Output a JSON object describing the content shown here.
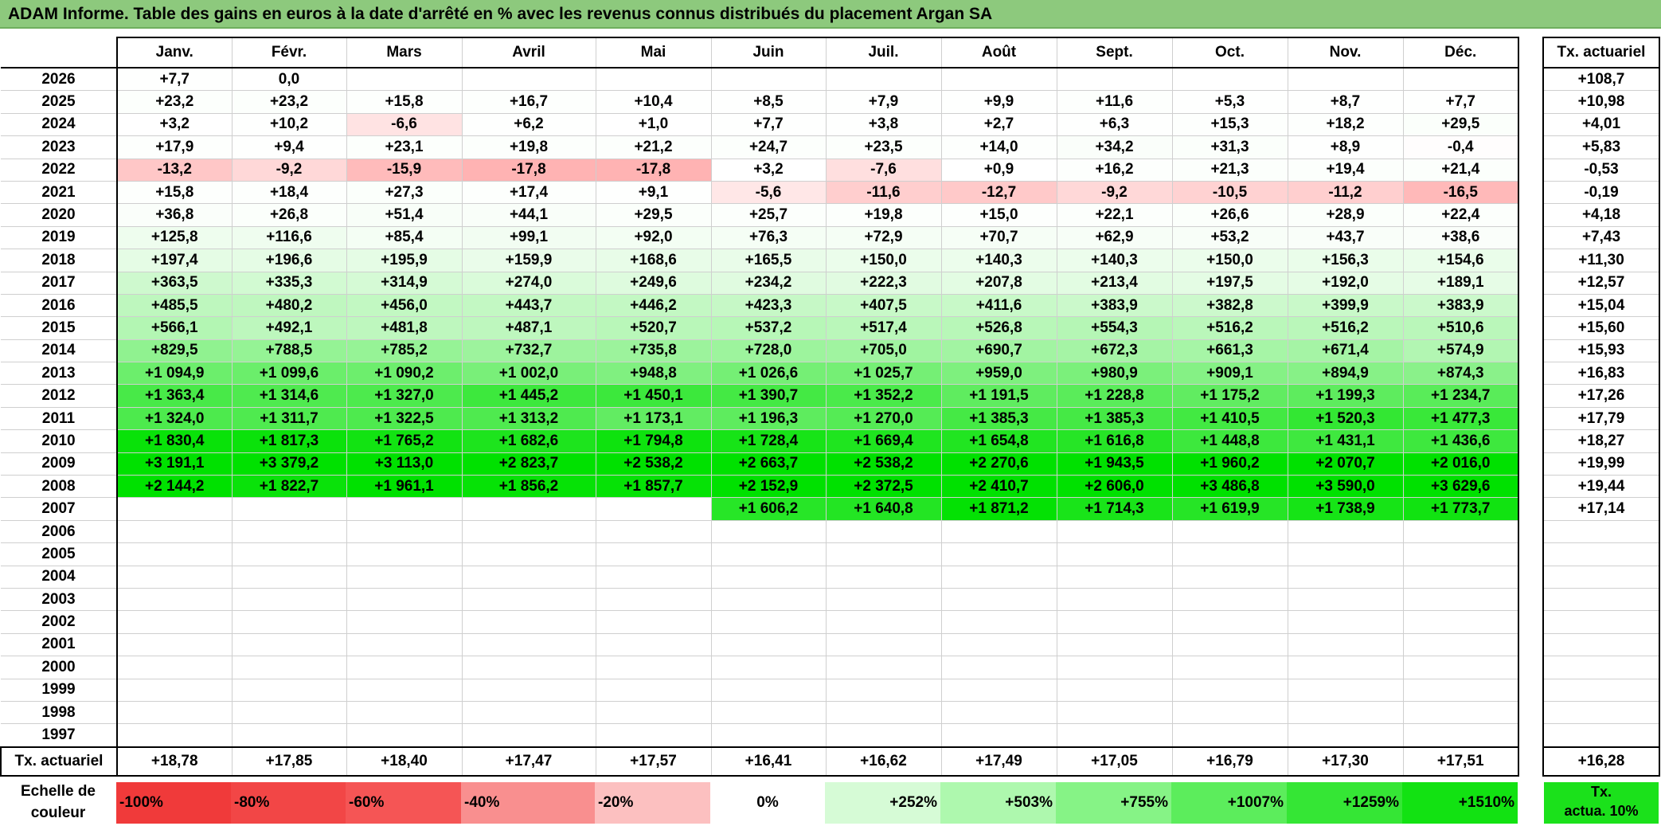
{
  "title": "ADAM Informe. Table des gains en euros à la date d'arrêté en % avec les revenus connus distribués du placement Argan SA",
  "months": [
    "Janv.",
    "Févr.",
    "Mars",
    "Avril",
    "Mai",
    "Juin",
    "Juil.",
    "Août",
    "Sept.",
    "Oct.",
    "Nov.",
    "Déc."
  ],
  "side_header": "Tx. actuariel",
  "rows": [
    {
      "year": "2026",
      "values": [
        "+7,7",
        "0,0",
        "",
        "",
        "",
        "",
        "",
        "",
        "",
        "",
        "",
        ""
      ],
      "tx": "+108,7"
    },
    {
      "year": "2025",
      "values": [
        "+23,2",
        "+23,2",
        "+15,8",
        "+16,7",
        "+10,4",
        "+8,5",
        "+7,9",
        "+9,9",
        "+11,6",
        "+5,3",
        "+8,7",
        "+7,7"
      ],
      "tx": "+10,98"
    },
    {
      "year": "2024",
      "values": [
        "+3,2",
        "+10,2",
        "-6,6",
        "+6,2",
        "+1,0",
        "+7,7",
        "+3,8",
        "+2,7",
        "+6,3",
        "+15,3",
        "+18,2",
        "+29,5"
      ],
      "tx": "+4,01"
    },
    {
      "year": "2023",
      "values": [
        "+17,9",
        "+9,4",
        "+23,1",
        "+19,8",
        "+21,2",
        "+24,7",
        "+23,5",
        "+14,0",
        "+34,2",
        "+31,3",
        "+8,9",
        "-0,4"
      ],
      "tx": "+5,83"
    },
    {
      "year": "2022",
      "values": [
        "-13,2",
        "-9,2",
        "-15,9",
        "-17,8",
        "-17,8",
        "+3,2",
        "-7,6",
        "+0,9",
        "+16,2",
        "+21,3",
        "+19,4",
        "+21,4"
      ],
      "tx": "-0,53"
    },
    {
      "year": "2021",
      "values": [
        "+15,8",
        "+18,4",
        "+27,3",
        "+17,4",
        "+9,1",
        "-5,6",
        "-11,6",
        "-12,7",
        "-9,2",
        "-10,5",
        "-11,2",
        "-16,5"
      ],
      "tx": "-0,19"
    },
    {
      "year": "2020",
      "values": [
        "+36,8",
        "+26,8",
        "+51,4",
        "+44,1",
        "+29,5",
        "+25,7",
        "+19,8",
        "+15,0",
        "+22,1",
        "+26,6",
        "+28,9",
        "+22,4"
      ],
      "tx": "+4,18"
    },
    {
      "year": "2019",
      "values": [
        "+125,8",
        "+116,6",
        "+85,4",
        "+99,1",
        "+92,0",
        "+76,3",
        "+72,9",
        "+70,7",
        "+62,9",
        "+53,2",
        "+43,7",
        "+38,6"
      ],
      "tx": "+7,43"
    },
    {
      "year": "2018",
      "values": [
        "+197,4",
        "+196,6",
        "+195,9",
        "+159,9",
        "+168,6",
        "+165,5",
        "+150,0",
        "+140,3",
        "+140,3",
        "+150,0",
        "+156,3",
        "+154,6"
      ],
      "tx": "+11,30"
    },
    {
      "year": "2017",
      "values": [
        "+363,5",
        "+335,3",
        "+314,9",
        "+274,0",
        "+249,6",
        "+234,2",
        "+222,3",
        "+207,8",
        "+213,4",
        "+197,5",
        "+192,0",
        "+189,1"
      ],
      "tx": "+12,57"
    },
    {
      "year": "2016",
      "values": [
        "+485,5",
        "+480,2",
        "+456,0",
        "+443,7",
        "+446,2",
        "+423,3",
        "+407,5",
        "+411,6",
        "+383,9",
        "+382,8",
        "+399,9",
        "+383,9"
      ],
      "tx": "+15,04"
    },
    {
      "year": "2015",
      "values": [
        "+566,1",
        "+492,1",
        "+481,8",
        "+487,1",
        "+520,7",
        "+537,2",
        "+517,4",
        "+526,8",
        "+554,3",
        "+516,2",
        "+516,2",
        "+510,6"
      ],
      "tx": "+15,60"
    },
    {
      "year": "2014",
      "values": [
        "+829,5",
        "+788,5",
        "+785,2",
        "+732,7",
        "+735,8",
        "+728,0",
        "+705,0",
        "+690,7",
        "+672,3",
        "+661,3",
        "+671,4",
        "+574,9"
      ],
      "tx": "+15,93"
    },
    {
      "year": "2013",
      "values": [
        "+1 094,9",
        "+1 099,6",
        "+1 090,2",
        "+1 002,0",
        "+948,8",
        "+1 026,6",
        "+1 025,7",
        "+959,0",
        "+980,9",
        "+909,1",
        "+894,9",
        "+874,3"
      ],
      "tx": "+16,83"
    },
    {
      "year": "2012",
      "values": [
        "+1 363,4",
        "+1 314,6",
        "+1 327,0",
        "+1 445,2",
        "+1 450,1",
        "+1 390,7",
        "+1 352,2",
        "+1 191,5",
        "+1 228,8",
        "+1 175,2",
        "+1 199,3",
        "+1 234,7"
      ],
      "tx": "+17,26"
    },
    {
      "year": "2011",
      "values": [
        "+1 324,0",
        "+1 311,7",
        "+1 322,5",
        "+1 313,2",
        "+1 173,1",
        "+1 196,3",
        "+1 270,0",
        "+1 385,3",
        "+1 385,3",
        "+1 410,5",
        "+1 520,3",
        "+1 477,3"
      ],
      "tx": "+17,79"
    },
    {
      "year": "2010",
      "values": [
        "+1 830,4",
        "+1 817,3",
        "+1 765,2",
        "+1 682,6",
        "+1 794,8",
        "+1 728,4",
        "+1 669,4",
        "+1 654,8",
        "+1 616,8",
        "+1 448,8",
        "+1 431,1",
        "+1 436,6"
      ],
      "tx": "+18,27"
    },
    {
      "year": "2009",
      "values": [
        "+3 191,1",
        "+3 379,2",
        "+3 113,0",
        "+2 823,7",
        "+2 538,2",
        "+2 663,7",
        "+2 538,2",
        "+2 270,6",
        "+1 943,5",
        "+1 960,2",
        "+2 070,7",
        "+2 016,0"
      ],
      "tx": "+19,99"
    },
    {
      "year": "2008",
      "values": [
        "+2 144,2",
        "+1 822,7",
        "+1 961,1",
        "+1 856,2",
        "+1 857,7",
        "+2 152,9",
        "+2 372,5",
        "+2 410,7",
        "+2 606,0",
        "+3 486,8",
        "+3 590,0",
        "+3 629,6"
      ],
      "tx": "+19,44"
    },
    {
      "year": "2007",
      "values": [
        "",
        "",
        "",
        "",
        "",
        "+1 606,2",
        "+1 640,8",
        "+1 871,2",
        "+1 714,3",
        "+1 619,9",
        "+1 738,9",
        "+1 773,7"
      ],
      "tx": "+17,14"
    },
    {
      "year": "2006",
      "values": [
        "",
        "",
        "",
        "",
        "",
        "",
        "",
        "",
        "",
        "",
        "",
        ""
      ],
      "tx": ""
    },
    {
      "year": "2005",
      "values": [
        "",
        "",
        "",
        "",
        "",
        "",
        "",
        "",
        "",
        "",
        "",
        ""
      ],
      "tx": ""
    },
    {
      "year": "2004",
      "values": [
        "",
        "",
        "",
        "",
        "",
        "",
        "",
        "",
        "",
        "",
        "",
        ""
      ],
      "tx": ""
    },
    {
      "year": "2003",
      "values": [
        "",
        "",
        "",
        "",
        "",
        "",
        "",
        "",
        "",
        "",
        "",
        ""
      ],
      "tx": ""
    },
    {
      "year": "2002",
      "values": [
        "",
        "",
        "",
        "",
        "",
        "",
        "",
        "",
        "",
        "",
        "",
        ""
      ],
      "tx": ""
    },
    {
      "year": "2001",
      "values": [
        "",
        "",
        "",
        "",
        "",
        "",
        "",
        "",
        "",
        "",
        "",
        ""
      ],
      "tx": ""
    },
    {
      "year": "2000",
      "values": [
        "",
        "",
        "",
        "",
        "",
        "",
        "",
        "",
        "",
        "",
        "",
        ""
      ],
      "tx": ""
    },
    {
      "year": "1999",
      "values": [
        "",
        "",
        "",
        "",
        "",
        "",
        "",
        "",
        "",
        "",
        "",
        ""
      ],
      "tx": ""
    },
    {
      "year": "1998",
      "values": [
        "",
        "",
        "",
        "",
        "",
        "",
        "",
        "",
        "",
        "",
        "",
        ""
      ],
      "tx": ""
    },
    {
      "year": "1997",
      "values": [
        "",
        "",
        "",
        "",
        "",
        "",
        "",
        "",
        "",
        "",
        "",
        ""
      ],
      "tx": ""
    }
  ],
  "footer": {
    "label": "Tx. actuariel",
    "values": [
      "+18,78",
      "+17,85",
      "+18,40",
      "+17,47",
      "+17,57",
      "+16,41",
      "+16,62",
      "+17,49",
      "+17,05",
      "+16,79",
      "+17,30",
      "+17,51"
    ],
    "total": "+16,28"
  },
  "scale": {
    "label_line1": "Echelle de",
    "label_line2": "couleur",
    "items": [
      {
        "label": "-100%",
        "color": "#f03a3a",
        "align": "left"
      },
      {
        "label": "-80%",
        "color": "#f24646",
        "align": "left"
      },
      {
        "label": "-60%",
        "color": "#f55555",
        "align": "left"
      },
      {
        "label": "-40%",
        "color": "#f98f8f",
        "align": "left"
      },
      {
        "label": "-20%",
        "color": "#fcc0c0",
        "align": "left"
      },
      {
        "label": "0%",
        "color": "#ffffff",
        "align": "center"
      },
      {
        "label": "+252%",
        "color": "#d6fbd6",
        "align": "right"
      },
      {
        "label": "+503%",
        "color": "#aef8ae",
        "align": "right"
      },
      {
        "label": "+755%",
        "color": "#86f386",
        "align": "right"
      },
      {
        "label": "+1007%",
        "color": "#5ced5c",
        "align": "right"
      },
      {
        "label": "+1259%",
        "color": "#35e635",
        "align": "right"
      },
      {
        "label": "+1510%",
        "color": "#12e212",
        "align": "right"
      }
    ],
    "side_line1": "Tx.",
    "side_line2": "actua. 10%",
    "side_color": "#1be11b"
  }
}
